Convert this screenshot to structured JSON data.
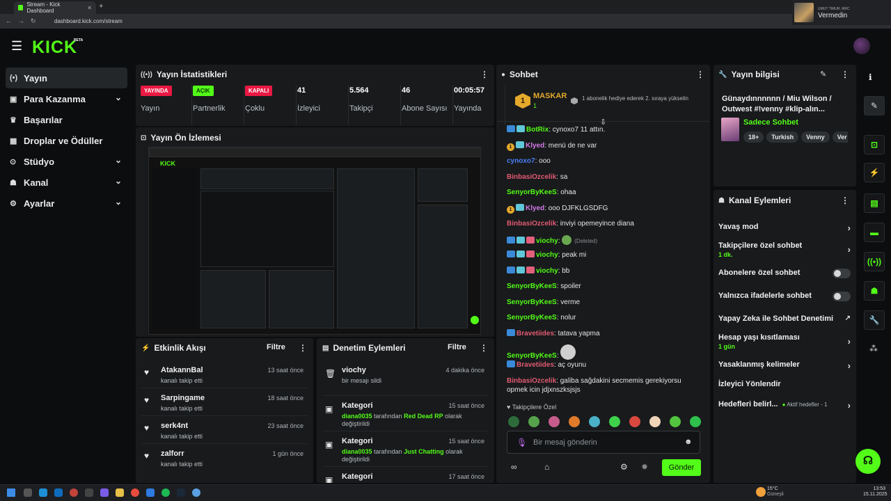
{
  "browser": {
    "tab_title": "Stream - Kick Dashboard",
    "new_tab": "+",
    "url": "dashboard.kick.com/stream",
    "profile_caption": "UMUT TIMUR, MRC",
    "profile_name": "Vermedin"
  },
  "header": {
    "logo": "KICK",
    "logo_sup": "BETA"
  },
  "sidebar": {
    "items": [
      {
        "label": "Yayın",
        "icon": "broadcast-icon",
        "glyph": "(•)",
        "expand": false
      },
      {
        "label": "Para Kazanma",
        "icon": "money-icon",
        "glyph": "▣",
        "expand": true
      },
      {
        "label": "Başarılar",
        "icon": "trophy-icon",
        "glyph": "♛",
        "expand": false
      },
      {
        "label": "Droplar ve Ödüller",
        "icon": "gift-icon",
        "glyph": "▦",
        "expand": false
      },
      {
        "label": "Stüdyo",
        "icon": "studio-icon",
        "glyph": "⊙",
        "expand": true
      },
      {
        "label": "Kanal",
        "icon": "channel-icon",
        "glyph": "☗",
        "expand": true
      },
      {
        "label": "Ayarlar",
        "icon": "gear-icon",
        "glyph": "⚙",
        "expand": true
      }
    ]
  },
  "stats": {
    "title": "Yayın İstatistikleri",
    "items": [
      {
        "value": "YAYINDA",
        "label": "Yayın",
        "color": "#e91943",
        "text_color": "#ffffff"
      },
      {
        "value": "AÇIK",
        "label": "Partnerlik",
        "color": "#53fc18",
        "text_color": "#0b3d00"
      },
      {
        "value": "KAPALI",
        "label": "Çoklu",
        "color": "#e91943",
        "text_color": "#ffffff"
      },
      {
        "value": "41",
        "label": "İzleyici"
      },
      {
        "value": "5.564",
        "label": "Takipçi"
      },
      {
        "value": "46",
        "label": "Abone Sayısı"
      },
      {
        "value": "00:05:57",
        "label": "Yayında Olduğu"
      }
    ]
  },
  "preview": {
    "title": "Yayın Ön İzlemesi"
  },
  "activity": {
    "title": "Etkinlik Akışı",
    "filter": "Filtre",
    "items": [
      {
        "name": "AtakannBal",
        "sub": "kanalı takip etti",
        "time": "13 saat önce"
      },
      {
        "name": "Sarpingame",
        "sub": "kanalı takip etti",
        "time": "18 saat önce"
      },
      {
        "name": "serk4nt",
        "sub": "kanalı takip etti",
        "time": "23 saat önce"
      },
      {
        "name": "zalforr",
        "sub": "kanalı takip etti",
        "time": "1 gün önce"
      }
    ]
  },
  "moderation": {
    "title": "Denetim Eylemleri",
    "filter": "Filtre",
    "items": [
      {
        "name": "viochy",
        "sub_pre": "bir mesajı sildi",
        "user": "",
        "mid": "",
        "cat": "",
        "post": "",
        "post2": "",
        "time": "4 dakika önce",
        "icon": "trash-icon"
      },
      {
        "name": "Kategori",
        "sub_pre": "",
        "user": "diana0035",
        "mid": " tarafından ",
        "cat": "Red Dead RP",
        "post": " olarak",
        "post2": "değiştirildi",
        "time": "15 saat önce",
        "icon": "category-icon"
      },
      {
        "name": "Kategori",
        "sub_pre": "",
        "user": "diana0035",
        "mid": " tarafından ",
        "cat": "Just Chatting",
        "post": " olarak",
        "post2": "değiştirildi",
        "time": "15 saat önce",
        "icon": "category-icon"
      },
      {
        "name": "Kategori",
        "sub_pre": "",
        "user": "",
        "mid": "",
        "cat": "",
        "post": "",
        "post2": "",
        "time": "17 saat önce",
        "icon": "category-icon"
      }
    ]
  },
  "chat": {
    "title": "Sohbet",
    "gift_name": "MASKAR",
    "gift_rank": "1",
    "gift_count": "1",
    "gift_text": "1 abonelik hediye ederek 2. sıraya yükselin",
    "messages": [
      {
        "user": "BotRix",
        "color": "#53fc18",
        "text": "cynoxo7 11 attın.",
        "badges": [
          "b-blue",
          "b-sub"
        ]
      },
      {
        "user": "Klyed",
        "color": "#d47ae8",
        "text": "menü de ne var",
        "badges": [
          "b-gold",
          "b-sub"
        ]
      },
      {
        "user": "cynoxo7",
        "color": "#4a7ef5",
        "text": "ooo",
        "badges": []
      },
      {
        "user": "BinbasiOzcelik",
        "color": "#e25a72",
        "text": "sa",
        "badges": []
      },
      {
        "user": "SenyorByKeeS",
        "color": "#53fc18",
        "text": "ohaa",
        "badges": []
      },
      {
        "user": "Klyed",
        "color": "#d47ae8",
        "text": "ooo DJFKLGSDFG",
        "badges": [
          "b-gold",
          "b-sub"
        ]
      },
      {
        "user": "BinbasiOzcelik",
        "color": "#e25a72",
        "text": "inviyi opemeyince diana",
        "badges": []
      },
      {
        "user": "viochy",
        "color": "#53fc18",
        "text": "(Deleted)",
        "badges": [
          "b-blue",
          "b-sub",
          "b-gift"
        ],
        "emote": true,
        "muted": true
      },
      {
        "user": "viochy",
        "color": "#53fc18",
        "text": "peak mi",
        "badges": [
          "b-blue",
          "b-sub",
          "b-gift"
        ]
      },
      {
        "user": "viochy",
        "color": "#53fc18",
        "text": "bb",
        "badges": [
          "b-blue",
          "b-sub",
          "b-gift"
        ]
      },
      {
        "user": "SenyorByKeeS",
        "color": "#53fc18",
        "text": "spoiler",
        "badges": []
      },
      {
        "user": "SenyorByKeeS",
        "color": "#53fc18",
        "text": "verme",
        "badges": []
      },
      {
        "user": "SenyorByKeeS",
        "color": "#53fc18",
        "text": "nolur",
        "badges": []
      },
      {
        "user": "Bravetiides",
        "color": "#e25a72",
        "text": "tatava yapma",
        "badges": [
          "b-blue"
        ]
      },
      {
        "user": "SenyorByKeeS",
        "color": "#53fc18",
        "text": "",
        "badges": [],
        "emote": true
      },
      {
        "user": "Bravetiides",
        "color": "#e25a72",
        "text": "aç oyunu",
        "badges": [
          "b-blue"
        ]
      },
      {
        "user": "BinbasiOzcelik",
        "color": "#e25a72",
        "text": "galiba sağdakini secmemis gerekiyorsu opmek icin jdjxnszksjsjs",
        "badges": []
      }
    ],
    "follower_mode": "Takipçilere Özel",
    "placeholder": "Bir mesaj gönderin",
    "send": "Gönder"
  },
  "stream_info": {
    "title": "Yayın bilgisi",
    "stream_title": "Günaydınnnnnn / Miu Wilson / Outwest #!venny #klip-alın...",
    "category": "Sadece Sohbet",
    "tags": [
      "18+",
      "Turkish",
      "Venny",
      "Ver"
    ]
  },
  "channel_actions": {
    "title": "Kanal Eylemleri",
    "items": [
      {
        "label": "Yavaş mod",
        "sub": "",
        "control": "chevron"
      },
      {
        "label": "Takipçilere özel sohbet",
        "sub": "1 dk.",
        "control": "chevron"
      },
      {
        "label": "Abonelere özel sohbet",
        "sub": "",
        "control": "toggle"
      },
      {
        "label": "Yalnızca ifadelerle sohbet",
        "sub": "",
        "control": "toggle"
      },
      {
        "label": "Yapay Zeka ile Sohbet Denetimi",
        "sub": "",
        "control": "external"
      },
      {
        "label": "Hesap yaşı kısıtlaması",
        "sub": "1 gün",
        "control": "chevron"
      },
      {
        "label": "Yasaklanmış kelimeler",
        "sub": "",
        "control": "chevron"
      },
      {
        "label": "İzleyici Yönlendir",
        "sub": "",
        "control": "none"
      },
      {
        "label": "Hedefleri belirl...",
        "sub": "",
        "control": "chevron",
        "extra": "Aktif hedefler - 1"
      }
    ]
  },
  "taskbar": {
    "weather": "15°C",
    "weather_sub": "Güneşli",
    "time": "13:53",
    "date": "15.11.2025"
  },
  "colors": {
    "brand": "#53fc18",
    "danger": "#e91943",
    "panel": "#181a1c",
    "bg": "#0b0d0e"
  }
}
